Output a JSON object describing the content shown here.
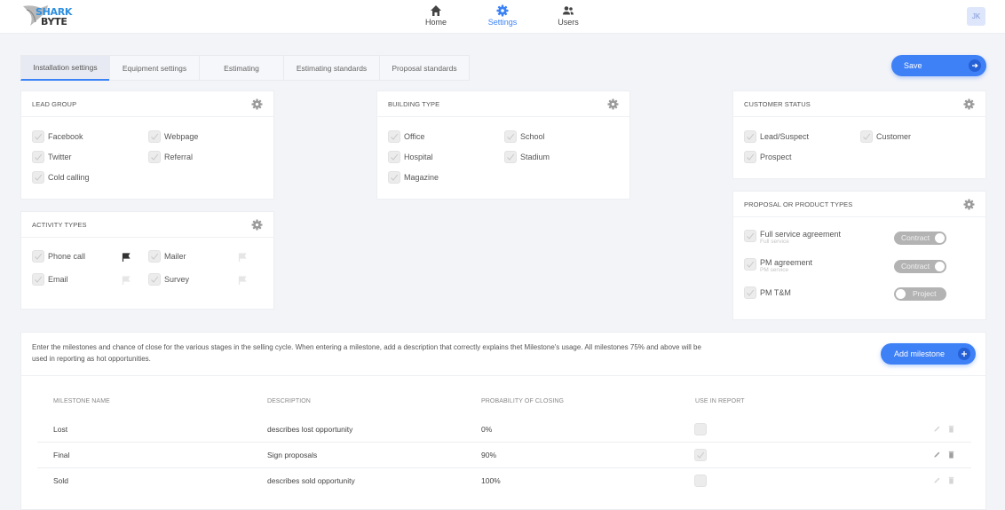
{
  "brand": {
    "line1": "SHARK",
    "line2": "BYTE"
  },
  "nav": [
    {
      "label": "Home",
      "icon": "home-icon",
      "active": false
    },
    {
      "label": "Settings",
      "icon": "gear-icon",
      "active": true
    },
    {
      "label": "Users",
      "icon": "users-icon",
      "active": false
    }
  ],
  "user": {
    "initials": "JK"
  },
  "tabs": [
    {
      "label": "Installation settings",
      "active": true
    },
    {
      "label": "Equipment settings",
      "active": false
    },
    {
      "label": "Estimating",
      "active": false
    },
    {
      "label": "Estimating standards",
      "active": false
    },
    {
      "label": "Proposal standards",
      "active": false
    }
  ],
  "save_label": "Save",
  "lead_group": {
    "title": "LEAD GROUP",
    "items": [
      {
        "label": "Facebook",
        "checked": true
      },
      {
        "label": "Webpage",
        "checked": true
      },
      {
        "label": "Twitter",
        "checked": true
      },
      {
        "label": "Referral",
        "checked": true
      },
      {
        "label": "Cold calling",
        "checked": true
      }
    ]
  },
  "activity_types": {
    "title": "ACTIVITY TYPES",
    "items": [
      {
        "label": "Phone call",
        "checked": true,
        "flagged": true
      },
      {
        "label": "Mailer",
        "checked": true,
        "flagged": false
      },
      {
        "label": "Email",
        "checked": true,
        "flagged": false
      },
      {
        "label": "Survey",
        "checked": true,
        "flagged": false
      }
    ]
  },
  "building_type": {
    "title": "BUILDING TYPE",
    "items": [
      {
        "label": "Office",
        "checked": true
      },
      {
        "label": "School",
        "checked": true
      },
      {
        "label": "Hospital",
        "checked": true
      },
      {
        "label": "Stadium",
        "checked": true
      },
      {
        "label": "Magazine",
        "checked": true
      }
    ]
  },
  "customer_status": {
    "title": "CUSTOMER STATUS",
    "items": [
      {
        "label": "Lead/Suspect",
        "checked": true
      },
      {
        "label": "Customer",
        "checked": true
      },
      {
        "label": "Prospect",
        "checked": true
      }
    ]
  },
  "proposal_types": {
    "title": "PROPOSAL OR PRODUCT TYPES",
    "items": [
      {
        "label": "Full service agreement",
        "sublabel": "Full service",
        "checked": true,
        "toggle": "Contract"
      },
      {
        "label": "PM agreement",
        "sublabel": "PM service",
        "checked": true,
        "toggle": "Contract"
      },
      {
        "label": "PM T&M",
        "sublabel": "",
        "checked": true,
        "toggle": "Project"
      }
    ]
  },
  "milestones": {
    "description": "Enter the milestones and chance of close for the various stages in the selling cycle. When entering a milestone, add a description that correctly explains thet Milestone's usage. All milestones 75% and above will be used in reporting as hot opportunities.",
    "add_label": "Add milestone",
    "columns": [
      "MILESTONE NAME",
      "DESCRIPTION",
      "PROBABILITY OF CLOSING",
      "USE IN REPORT"
    ],
    "rows": [
      {
        "name": "Lost",
        "description": "describes lost opportunity",
        "probability": "0%",
        "use_in_report": false
      },
      {
        "name": "Final",
        "description": "Sign proposals",
        "probability": "90%",
        "use_in_report": true
      },
      {
        "name": "Sold",
        "description": "describes sold opportunity",
        "probability": "100%",
        "use_in_report": false
      }
    ]
  }
}
